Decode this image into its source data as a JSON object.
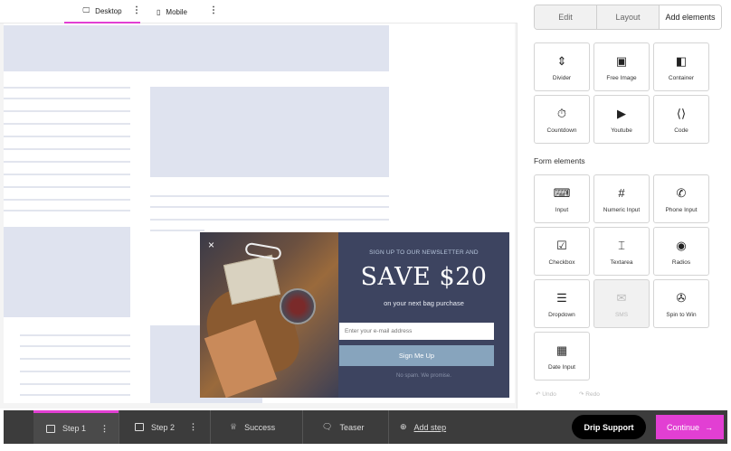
{
  "device_bar": {
    "desktop_label": "Desktop",
    "mobile_label": "Mobile",
    "more": "⋮"
  },
  "popup": {
    "close": "×",
    "eyebrow": "SIGN UP TO OUR NEWSLETTER AND",
    "title": "SAVE $20",
    "subtitle": "on your next bag purchase",
    "email_placeholder": "Enter your e-mail address",
    "submit_label": "Sign Me Up",
    "note": "No spam. We promise."
  },
  "panel": {
    "tabs": [
      "Edit",
      "Layout",
      "Add elements"
    ],
    "elements": [
      {
        "label": "Divider",
        "icon": "divider-icon",
        "glyph": "⇕"
      },
      {
        "label": "Free Image",
        "icon": "image-icon",
        "glyph": "▣"
      },
      {
        "label": "Container",
        "icon": "container-icon",
        "glyph": "◧"
      },
      {
        "label": "Countdown",
        "icon": "countdown-icon",
        "glyph": "⏱"
      },
      {
        "label": "Youtube",
        "icon": "youtube-icon",
        "glyph": "▶"
      },
      {
        "label": "Code",
        "icon": "code-icon",
        "glyph": "⟨⟩"
      }
    ],
    "form_section_title": "Form elements",
    "form_elements": [
      {
        "label": "Input",
        "icon": "input-icon",
        "glyph": "⌨"
      },
      {
        "label": "Numeric Input",
        "icon": "hash-icon",
        "glyph": "#"
      },
      {
        "label": "Phone Input",
        "icon": "phone-icon",
        "glyph": "✆"
      },
      {
        "label": "Checkbox",
        "icon": "checkbox-icon",
        "glyph": "☑"
      },
      {
        "label": "Textarea",
        "icon": "textarea-icon",
        "glyph": "⌶"
      },
      {
        "label": "Radios",
        "icon": "radio-icon",
        "glyph": "◉"
      },
      {
        "label": "Dropdown",
        "icon": "dropdown-icon",
        "glyph": "☰"
      },
      {
        "label": "SMS",
        "icon": "sms-icon",
        "glyph": "✉",
        "disabled": true
      },
      {
        "label": "Spin to Win",
        "icon": "spin-wheel-icon",
        "glyph": "✇"
      },
      {
        "label": "Date Input",
        "icon": "calendar-icon",
        "glyph": "▦"
      }
    ],
    "undo_label": "Undo",
    "redo_label": "Redo"
  },
  "steps": {
    "items": [
      {
        "label": "Step 1",
        "active": true
      },
      {
        "label": "Step 2",
        "active": false
      },
      {
        "label": "Success",
        "active": false
      },
      {
        "label": "Teaser",
        "active": false
      }
    ],
    "add_step_label": "Add step",
    "more": "⋮"
  },
  "actions": {
    "drip_support_label": "Drip Support",
    "continue_label": "Continue",
    "continue_arrow": "→"
  },
  "colors": {
    "accent": "#e23fd3",
    "popup_bg": "#3d4460",
    "popup_button": "#87a4bd",
    "placeholder_block": "#dfe3ef",
    "footer_bg": "#3c3c3c"
  }
}
